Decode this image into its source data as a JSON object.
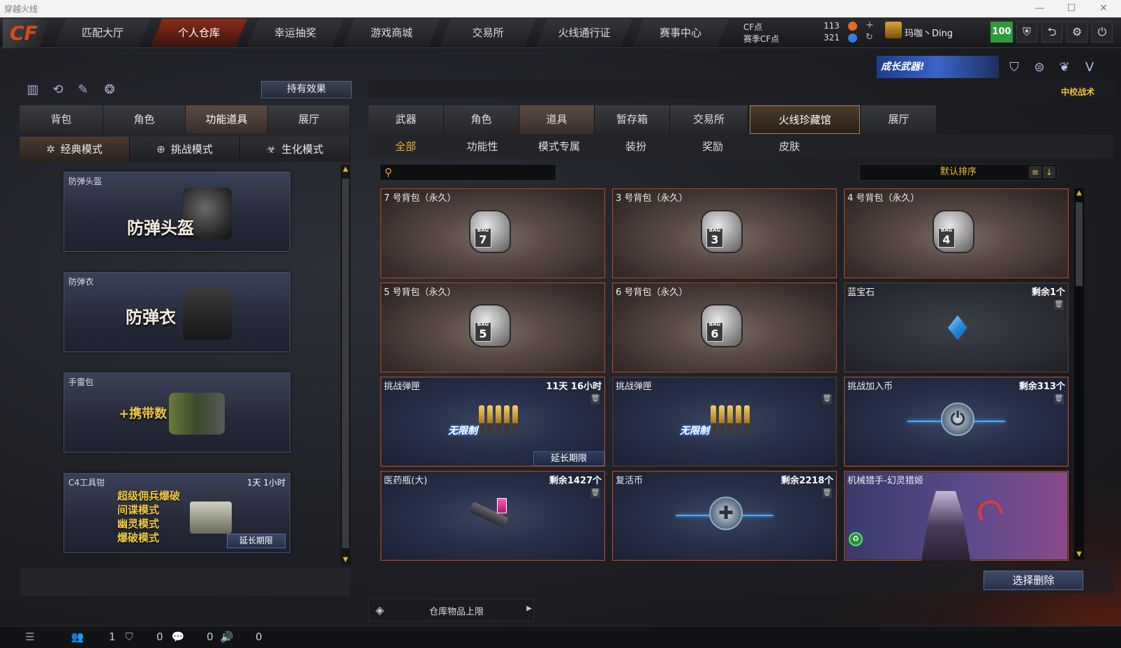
{
  "window": {
    "title": "穿越火线"
  },
  "topnav": {
    "tabs": [
      {
        "label": "匹配大厅"
      },
      {
        "label": "个人仓库",
        "active": true
      },
      {
        "label": "幸运抽奖"
      },
      {
        "label": "游戏商城"
      },
      {
        "label": "交易所"
      },
      {
        "label": "火线通行证"
      },
      {
        "label": "赛事中心"
      }
    ],
    "cf_label": "CF点",
    "season_cf_label": "赛季CF点",
    "cf_value": "113",
    "season_cf_value": "321",
    "player_name": "玛咖丶Ding",
    "level": "100",
    "logo_text": "CF"
  },
  "left_panel": {
    "hold_effect_label": "持有效果",
    "tabs": [
      "背包",
      "角色",
      "功能道具",
      "展厅"
    ],
    "active_tab": 2,
    "modes": [
      "经典模式",
      "挑战模式",
      "生化模式"
    ],
    "items": [
      {
        "name": "防弹头盔",
        "big": "防弹头盔"
      },
      {
        "name": "防弹衣",
        "big": "防弹衣"
      },
      {
        "name": "手雷包",
        "big": "+携带数"
      },
      {
        "name": "C4工具钳",
        "timer": "1天 1小时",
        "lines": [
          "超级佣兵爆破",
          "间谍模式",
          "幽灵模式",
          "爆破模式"
        ],
        "extend_label": "延长期限"
      }
    ]
  },
  "right_panel": {
    "banner_text": "成长武器!",
    "rank": "中校战术",
    "tabs": [
      "武器",
      "角色",
      "道具",
      "暂存箱",
      "交易所",
      "火线珍藏馆",
      "展厅"
    ],
    "active_tab": 2,
    "subtabs": [
      "全部",
      "功能性",
      "模式专属",
      "装扮",
      "奖励",
      "皮肤"
    ],
    "active_subtab": 0,
    "search_placeholder": "",
    "sort_label": "默认排序",
    "items": [
      {
        "name": "7 号背包（永久）",
        "type": "bag",
        "num": "7"
      },
      {
        "name": "3 号背包（永久）",
        "type": "bag",
        "num": "3"
      },
      {
        "name": "4 号背包（永久）",
        "type": "bag",
        "num": "4"
      },
      {
        "name": "5 号背包（永久）",
        "type": "bag",
        "num": "5"
      },
      {
        "name": "6 号背包（永久）",
        "type": "bag",
        "num": "6"
      },
      {
        "name": "蓝宝石",
        "type": "gem",
        "right": "剩余1个"
      },
      {
        "name": "挑战弹匣",
        "type": "ammo",
        "right": "11天 16小时",
        "extend_label": "延长期限",
        "badge": "无限制"
      },
      {
        "name": "挑战弹匣",
        "type": "ammo",
        "badge": "无限制"
      },
      {
        "name": "挑战加入币",
        "type": "coin",
        "right": "剩余313个"
      },
      {
        "name": "医药瓶(大)",
        "type": "pistol",
        "right": "剩余1427个"
      },
      {
        "name": "复活币",
        "type": "revive",
        "right": "剩余2218个"
      },
      {
        "name": "机械猎手-幻灵猎姬",
        "type": "hero"
      }
    ],
    "delete_label": "选择删除",
    "capacity_label": "仓库物品上限"
  },
  "statusbar": {
    "counts": [
      "1",
      "0",
      "0",
      "0"
    ]
  }
}
